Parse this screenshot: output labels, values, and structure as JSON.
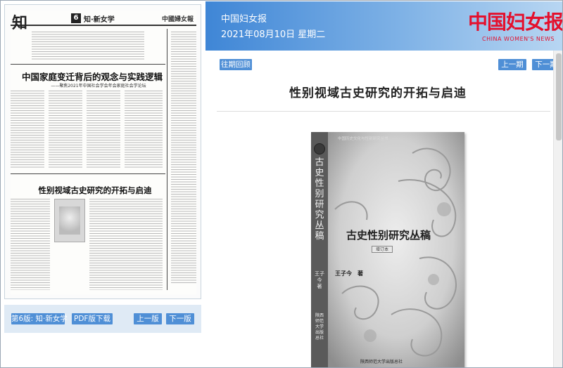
{
  "left": {
    "thumbnail": {
      "zhi": "知",
      "page_num": "6",
      "section": "知·新女学",
      "paper_logo": "中國婦女報",
      "headline_1": "中国家庭变迁背后的观念与实践逻辑",
      "subhead_1": "——聚焦2021年中国社会学会年会家庭社会学论坛",
      "headline_2": "性别视域古史研究的开拓与启迪"
    },
    "page_button": "第6版: 知·新女学",
    "pdf_button": "PDF版下载",
    "prev_page": "上一版",
    "next_page": "下一版"
  },
  "header": {
    "paper_name": "中国妇女报",
    "date": "2021年08月10日 星期二",
    "brand": "中国妇女报",
    "brand_en": "CHINA WOMEN'S NEWS"
  },
  "toolbar": {
    "archive": "往期回顾",
    "prev_issue": "上一期",
    "next_issue": "下一期"
  },
  "article": {
    "title": "性别视域古史研究的开拓与启迪",
    "book": {
      "series": "中国历史文化与性别研究丛书",
      "spine_title": "古史性别研究丛稿",
      "title": "古史性别研究丛稿",
      "edition": "增订本",
      "author": "王子今　著",
      "publisher": "陕西师范大学出版总社"
    }
  },
  "colors": {
    "banner_start": "#3f86d6",
    "button_blue": "#4f8fd6",
    "brand_red": "#e4102d",
    "book_grey": "#6e6e6e"
  }
}
